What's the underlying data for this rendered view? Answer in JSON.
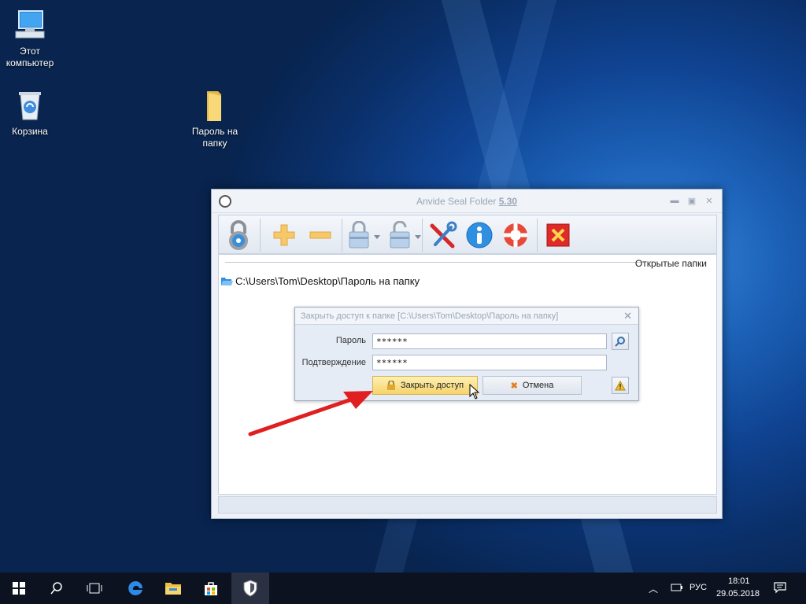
{
  "desktop": {
    "icons": [
      {
        "label": "Этот компьютер"
      },
      {
        "label": "Корзина"
      },
      {
        "label": "Пароль на папку"
      }
    ]
  },
  "window": {
    "title": "Anvide Seal Folder",
    "version": "5.30",
    "panel_header": "Открытые папки",
    "folder_path": "C:\\Users\\Tom\\Desktop\\Пароль на папку"
  },
  "dialog": {
    "title": "Закрыть доступ к папке [C:\\Users\\Tom\\Desktop\\Пароль на папку]",
    "password_label": "Пароль",
    "password_value": "******",
    "confirm_label": "Подтверждение",
    "confirm_value": "******",
    "lock_button": "Закрыть доступ",
    "cancel_button": "Отмена"
  },
  "taskbar": {
    "language": "РУС",
    "time": "18:01",
    "date": "29.05.2018"
  },
  "colors": {
    "accent_red": "#e02020",
    "primary_button": "#f6d36b"
  }
}
